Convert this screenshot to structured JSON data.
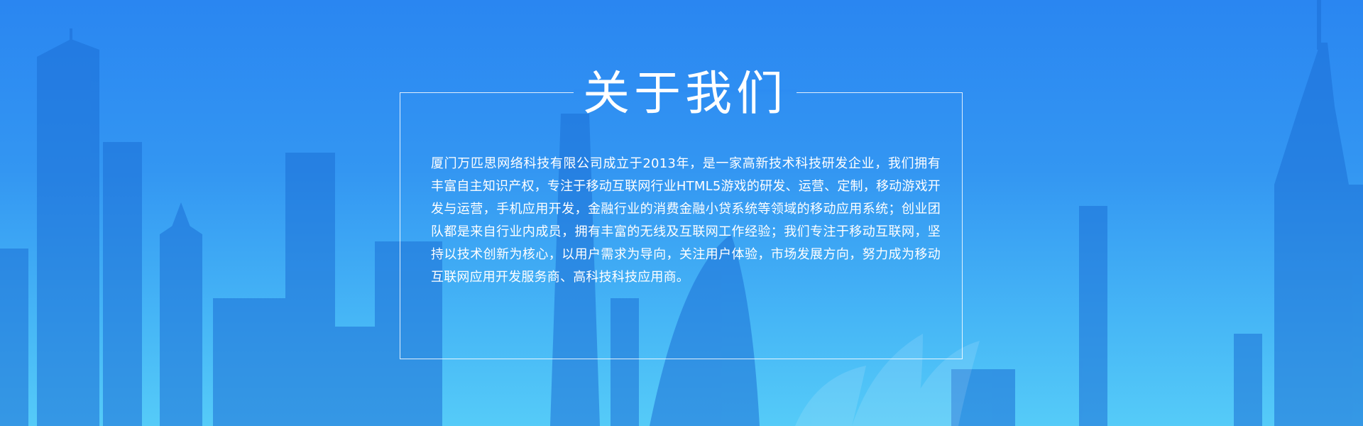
{
  "about": {
    "title": "关于我们",
    "body": "厦门万匹思网络科技有限公司成立于2013年，是一家高新技术科技研发企业，我们拥有丰富自主知识产权，专注于移动互联网行业HTML5游戏的研发、运营、定制，移动游戏开发与运营，手机应用开发，金融行业的消费金融小贷系统等领域的移动应用系统；创业团队都是来自行业内成员，拥有丰富的无线及互联网工作经验；我们专注于移动互联网，坚持以技术创新为核心，以用户需求为导向，关注用户体验，市场发展方向，努力成为移动互联网应用开发服务商、高科技科技应用商。"
  },
  "colors": {
    "background_top": "#2a86f1",
    "background_bottom": "#55cbf8",
    "text": "#ffffff",
    "frame_border": "#ffffff"
  }
}
